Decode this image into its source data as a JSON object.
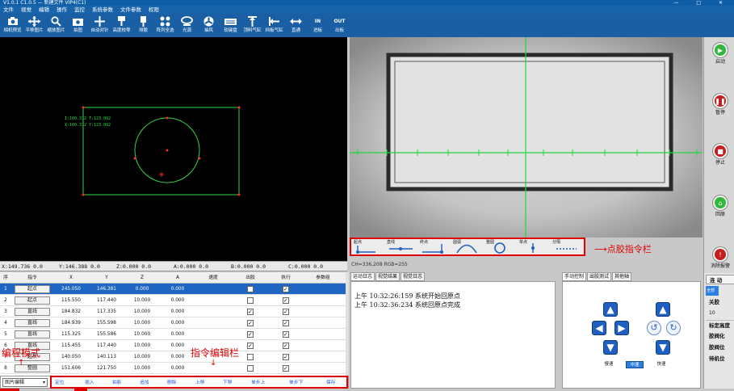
{
  "titlebar": {
    "text": "V1.0.1 C1.0.5 — 新建文件 VIP4(C1)"
  },
  "menu": [
    "文件",
    "视觉",
    "编辑",
    "操作",
    "监控",
    "系统参数",
    "文件参数",
    "权限"
  ],
  "toolbar": [
    {
      "label": "相机预览",
      "icon": "camera-icon"
    },
    {
      "label": "平移图片",
      "icon": "move-icon"
    },
    {
      "label": "缩放图片",
      "icon": "zoom-icon"
    },
    {
      "label": "拍图",
      "icon": "capture-icon"
    },
    {
      "label": "自动对针",
      "icon": "crosshair-icon"
    },
    {
      "label": "高度校零",
      "icon": "height-zero-icon"
    },
    {
      "label": "排胶",
      "icon": "purge-icon"
    },
    {
      "label": "阵列全选",
      "icon": "array-select-icon"
    },
    {
      "label": "光源",
      "icon": "light-icon"
    },
    {
      "label": "抽风",
      "icon": "fan-icon"
    },
    {
      "label": "软键盘",
      "icon": "keyboard-icon"
    },
    {
      "label": "顶料气缸",
      "icon": "lift-cylinder-icon"
    },
    {
      "label": "挡板气缸",
      "icon": "stop-cylinder-icon"
    },
    {
      "label": "直通",
      "icon": "passthrough-icon"
    },
    {
      "label": "进板",
      "icon": "board-in-icon",
      "glyph": "IN"
    },
    {
      "label": "出板",
      "icon": "board-out-icon",
      "glyph": "OUT"
    }
  ],
  "preview": {
    "coord_line1": "I:100.312 T:123.002",
    "coord_line2": "X:100.312 Y:123.002"
  },
  "coords": [
    "X:149.736 0.0",
    "Y:146.388 0.0",
    "Z:0.000 0.0",
    "A:0.000 0.0",
    "B:0.000 0.0",
    "C:0.000 0.0"
  ],
  "grid": {
    "headers": [
      "序",
      "指令",
      "X",
      "Y",
      "Z",
      "A",
      "速度",
      "出胶",
      "执行",
      "参数组"
    ],
    "rows": [
      {
        "n": "1",
        "cmd": "起点",
        "x": "245.050",
        "y": "146.381",
        "z": "0.000",
        "a": "0.000",
        "glue": false,
        "exec": true
      },
      {
        "n": "2",
        "cmd": "起点",
        "x": "115.550",
        "y": "117.440",
        "z": "10.000",
        "a": "0.000",
        "glue": false,
        "exec": true
      },
      {
        "n": "3",
        "cmd": "直线",
        "x": "184.832",
        "y": "117.335",
        "z": "10.000",
        "a": "0.000",
        "glue": true,
        "exec": true
      },
      {
        "n": "4",
        "cmd": "直线",
        "x": "184.939",
        "y": "155.598",
        "z": "10.000",
        "a": "0.000",
        "glue": true,
        "exec": true
      },
      {
        "n": "5",
        "cmd": "直线",
        "x": "115.325",
        "y": "155.586",
        "z": "10.000",
        "a": "0.000",
        "glue": true,
        "exec": true
      },
      {
        "n": "6",
        "cmd": "直线",
        "x": "115.455",
        "y": "117.440",
        "z": "10.000",
        "a": "0.000",
        "glue": true,
        "exec": true
      },
      {
        "n": "7",
        "cmd": "起点",
        "x": "140.050",
        "y": "140.113",
        "z": "10.000",
        "a": "0.000",
        "glue": false,
        "exec": true
      },
      {
        "n": "8",
        "cmd": "整圆",
        "x": "151.606",
        "y": "121.750",
        "z": "10.000",
        "a": "0.000",
        "glue": false,
        "exec": true
      }
    ]
  },
  "editbar": {
    "mode": "图片编辑",
    "buttons": [
      "定位",
      "插入",
      "拍影",
      "追加",
      "删除",
      "上移",
      "下移",
      "单步上",
      "单步下",
      "保存"
    ]
  },
  "annotations": {
    "mode": "编程模式",
    "edit": "指令编辑栏",
    "dispense": "点胶指令栏"
  },
  "dispense_cmds": [
    {
      "label": "起点",
      "icon": "start-point-icon"
    },
    {
      "label": "直线",
      "icon": "line-icon"
    },
    {
      "label": "终点",
      "icon": "end-point-icon"
    },
    {
      "label": "圆弧",
      "icon": "arc-icon"
    },
    {
      "label": "整圆",
      "icon": "circle-icon"
    },
    {
      "label": "单点",
      "icon": "single-point-icon"
    },
    {
      "label": "分隔",
      "icon": "separator-icon"
    }
  ],
  "statusline": "CH=336,208  RGB=255",
  "logtabs": [
    "运动日志",
    "视觉结果",
    "视觉日志"
  ],
  "logs": [
    "上午 10:32:26:159 系统开始回原点",
    "上午 10:32:36:234 系统回原点完成"
  ],
  "ctrltabs": [
    "手动控制",
    "出胶测试",
    "其他轴"
  ],
  "speeds": [
    "慢速",
    "中速",
    "快速"
  ],
  "sidebar": [
    {
      "label": "启动",
      "icon": "start-icon",
      "color": "#2fb83b"
    },
    {
      "label": "暂停",
      "icon": "pause-icon",
      "color": "#c31f1f"
    },
    {
      "label": "停止",
      "icon": "stop-icon",
      "color": "#c31f1f"
    },
    {
      "label": "回原",
      "icon": "home-icon",
      "color": "#2fb83b"
    },
    {
      "label": "消除报警",
      "icon": "clear-alarm-icon",
      "color": "#c31f1f"
    }
  ],
  "axis_panel": [
    "连 动",
    "关胶",
    "标定高度",
    "胶阀化",
    "胶阀位",
    "待机位"
  ],
  "axis_select": "全部",
  "axis_value": "10"
}
